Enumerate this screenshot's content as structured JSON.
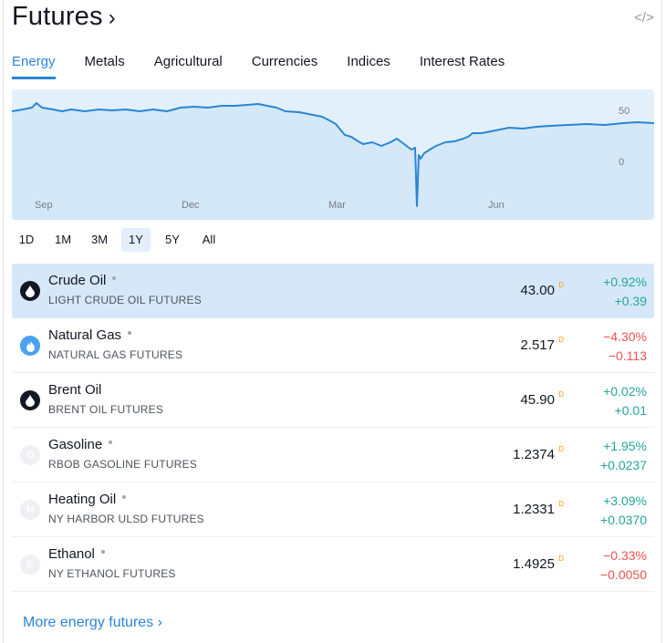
{
  "header": {
    "title": "Futures",
    "chevron": "›",
    "embed_icon": "</>"
  },
  "tabs": [
    {
      "label": "Energy",
      "active": true
    },
    {
      "label": "Metals",
      "active": false
    },
    {
      "label": "Agricultural",
      "active": false
    },
    {
      "label": "Currencies",
      "active": false
    },
    {
      "label": "Indices",
      "active": false
    },
    {
      "label": "Interest Rates",
      "active": false
    }
  ],
  "chart": {
    "x_labels": [
      "Sep",
      "Dec",
      "Mar",
      "Jun"
    ],
    "y_labels": [
      "50",
      "0"
    ],
    "line_color": "#2a85d6",
    "fill_color": "#e3f0fb"
  },
  "ranges": [
    {
      "label": "1D",
      "active": false
    },
    {
      "label": "1M",
      "active": false
    },
    {
      "label": "3M",
      "active": false
    },
    {
      "label": "1Y",
      "active": true
    },
    {
      "label": "5Y",
      "active": false
    },
    {
      "label": "All",
      "active": false
    }
  ],
  "rows": [
    {
      "name": "Crude Oil",
      "sub": "LIGHT CRUDE OIL FUTURES",
      "price": "43.00",
      "flag": "D",
      "pct": "+0.92%",
      "chg": "+0.39",
      "dir": "up",
      "logo": "drop-icon",
      "logo_style": "black",
      "logo_letter": ""
    },
    {
      "name": "Natural Gas",
      "sub": "NATURAL GAS FUTURES",
      "price": "2.517",
      "flag": "D",
      "pct": "−4.30%",
      "chg": "−0.113",
      "dir": "down",
      "logo": "flame-icon",
      "logo_style": "blue",
      "logo_letter": ""
    },
    {
      "name": "Brent Oil",
      "sub": "BRENT OIL FUTURES",
      "price": "45.90",
      "flag": "D",
      "pct": "+0.02%",
      "chg": "+0.01",
      "dir": "up",
      "logo": "drop-icon",
      "logo_style": "black",
      "logo_letter": ""
    },
    {
      "name": "Gasoline",
      "sub": "RBOB GASOLINE FUTURES",
      "price": "1.2374",
      "flag": "D",
      "pct": "+1.95%",
      "chg": "+0.0237",
      "dir": "up",
      "logo": "letter-icon",
      "logo_style": "pale",
      "logo_letter": "G"
    },
    {
      "name": "Heating Oil",
      "sub": "NY HARBOR ULSD FUTURES",
      "price": "1.2331",
      "flag": "D",
      "pct": "+3.09%",
      "chg": "+0.0370",
      "dir": "up",
      "logo": "letter-icon",
      "logo_style": "pale",
      "logo_letter": "H"
    },
    {
      "name": "Ethanol",
      "sub": "NY ETHANOL FUTURES",
      "price": "1.4925",
      "flag": "D",
      "pct": "−0.33%",
      "chg": "−0.0050",
      "dir": "down",
      "logo": "letter-icon",
      "logo_style": "pale",
      "logo_letter": "E"
    }
  ],
  "more_link": "More energy futures ›"
}
